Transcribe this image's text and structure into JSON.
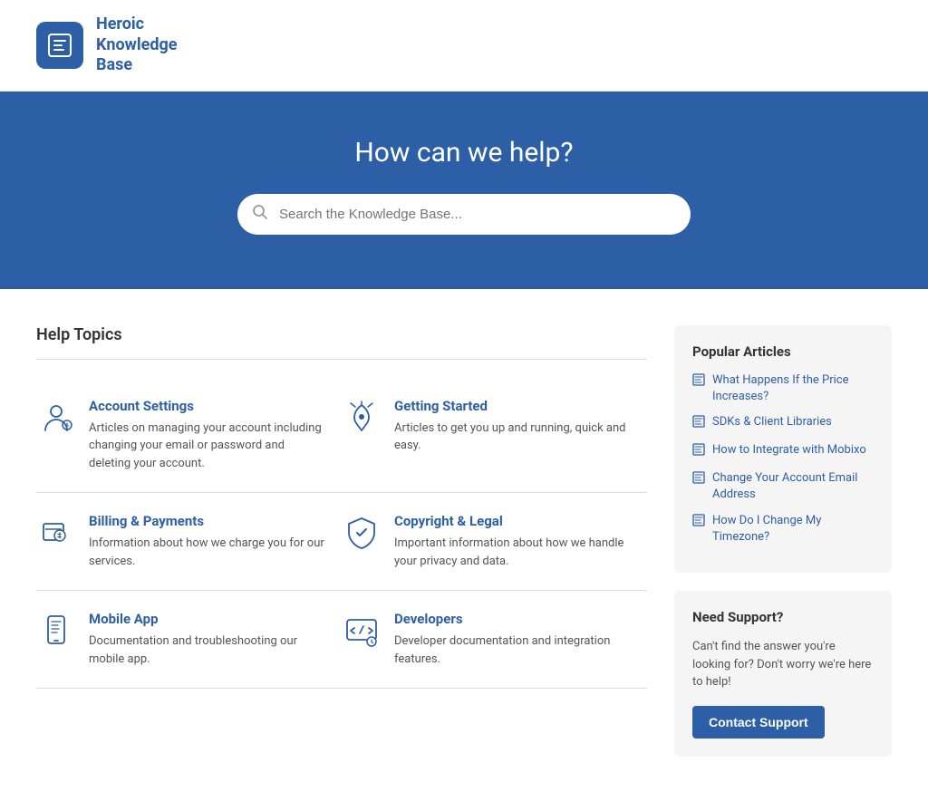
{
  "header": {
    "logo_alt": "Heroic Knowledge Base logo",
    "brand_line1": "Heroic",
    "brand_line2": "Knowledge",
    "brand_line3": "Base"
  },
  "hero": {
    "title": "How can we help?",
    "search_placeholder": "Search the Knowledge Base..."
  },
  "content": {
    "help_topics_label": "Help Topics",
    "topics": [
      {
        "id": "account-settings",
        "title": "Account Settings",
        "description": "Articles on managing your account including changing your email or password and deleting your account."
      },
      {
        "id": "getting-started",
        "title": "Getting Started",
        "description": "Articles to get you up and running, quick and easy."
      },
      {
        "id": "billing-payments",
        "title": "Billing & Payments",
        "description": "Information about how we charge you for our services."
      },
      {
        "id": "copyright-legal",
        "title": "Copyright & Legal",
        "description": "Important information about how we handle your privacy and data."
      },
      {
        "id": "mobile-app",
        "title": "Mobile App",
        "description": "Documentation and troubleshooting our mobile app."
      },
      {
        "id": "developers",
        "title": "Developers",
        "description": "Developer documentation and integration features."
      }
    ]
  },
  "sidebar": {
    "popular_title": "Popular Articles",
    "articles": [
      {
        "label": "What Happens If the Price Increases?"
      },
      {
        "label": "SDKs & Client Libraries"
      },
      {
        "label": "How to Integrate with Mobixo"
      },
      {
        "label": "Change Your Account Email Address"
      },
      {
        "label": "How Do I Change My Timezone?"
      }
    ],
    "support_title": "Need Support?",
    "support_desc": "Can't find the answer you're looking for? Don't worry we're here to help!",
    "contact_label": "Contact Support"
  }
}
